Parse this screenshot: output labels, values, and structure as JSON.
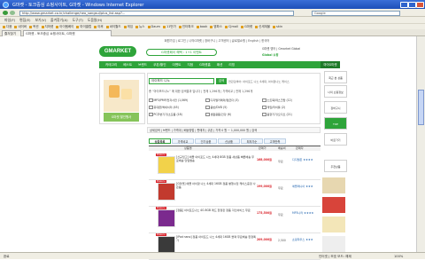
{
  "window": {
    "title": "G마켓 - 토크중심 쇼핑사이트, G마켓 - Windows Internet Explorer"
  },
  "address": {
    "url": "http://www.gmarket.co.kr/challenge/neo_sangsul/plus_list.asp?...",
    "search_placeholder": "Google"
  },
  "menu": [
    "파일(F)",
    "편집(E)",
    "보기(V)",
    "즐겨찾기(A)",
    "도구(T)",
    "도움말(H)"
  ],
  "links": [
    "다음",
    "네이버",
    "옥션",
    "지마켓",
    "아이템베이",
    "마이클럽",
    "야후",
    "싸이월드",
    "게임",
    "뉴스",
    "Daum",
    "11번가",
    "인터파크",
    "book",
    "엠파스",
    "CJmall",
    "G마켓",
    "신세계몰",
    "skin"
  ],
  "tabs": [
    {
      "label": "즐겨찾기"
    },
    {
      "label": "G마켓 - 토크중심 쇼핑사이트, G마켓"
    }
  ],
  "topnav": {
    "text": "회원가입 | 로그인 | 나의G마켓 | 장바구니 | 고객센터 | 글로벌쇼핑 | English | 한국어"
  },
  "logo": {
    "text": "GMARKET"
  },
  "promo": {
    "text": "G마켓페이 혜택 : 1+1 이벤트"
  },
  "rightlogos": {
    "line1": "G마켓 영어 | Gmarket Global",
    "line2": "Global 쇼핑"
  },
  "nav": {
    "items": [
      "카테고리",
      "베스트",
      "브랜드",
      "쿠폰/할인",
      "이벤트",
      "지점",
      "G마켓홈",
      "패션",
      "리빙"
    ],
    "right": "마이G마켓"
  },
  "leftad": {
    "label": "G마켓 할인행사"
  },
  "search": {
    "value": "아이포드 나노",
    "button": "검색",
    "hint": "연관검색어: 아이포드 나노 4세대, 아이팟나노 케이스"
  },
  "result_info": "총 “아이포드나노” 에 대한 검색결과 입니다 | 전체 1,296개 | 가격비교 | 전체 1,296개",
  "categories": [
    {
      "label": "MP3/PMP/전자사전 (1,069)"
    },
    {
      "label": "디지털카메라/캠코더 (3)"
    },
    {
      "label": "노트북/데스크탑 (12)"
    },
    {
      "label": "휴대폰/액세서리 (45)"
    },
    {
      "label": "음반/DVD (5)"
    },
    {
      "label": "게임/타이틀 (2)"
    },
    {
      "label": "PC주변기기/소모품 (18)"
    },
    {
      "label": "생활용품/건강 (6)"
    },
    {
      "label": "음향기기/오디오 (21)"
    }
  ],
  "filter": {
    "text": "상세검색 | 브랜드 | 가격대 | 배송방법 | 판매자 | 쿠폰 | 가격 0 원 ~ 1,000,000 원 | 검색"
  },
  "subtabs": [
    "상품목록",
    "가격비교",
    "인기상품",
    "신상품",
    "최저가순",
    "고객만족"
  ],
  "sort": {
    "item": "상품명",
    "price": "판매가",
    "shipping": "배송비",
    "seller": "판매자"
  },
  "products": [
    {
      "tag": "Power+",
      "desc": "[신규입고] 애플 아이포드 나노 4세대 8GB 정품 새상품 빠른배송 무료배송 당일발송",
      "price": "168,000원",
      "ship": "무료",
      "seller": "디지털존 ★★★★"
    },
    {
      "tag": "Power+",
      "desc": "[G마켓] 애플 아이팟 나노 4세대 16GB 정품 병행수입 케이스증정 사은품",
      "price": "199,000원",
      "ship": "무료",
      "seller": "애플매니아 ★★★"
    },
    {
      "tag": "Power+",
      "desc": "[정품] 아이포드나노 4G 8GB 레드 한정판 정품 각인서비스 무료",
      "price": "175,500원",
      "ship": "무료",
      "seller": "MP3나라 ★★★★"
    },
    {
      "tag": "Power+",
      "desc": "[iPod nano] 정품 아이포드 나노 4세대 16GB 블랙 무료배송 한정특가",
      "price": "209,000원",
      "ship": "2,500",
      "seller": "쇼핑하우스 ★★★"
    }
  ],
  "right": {
    "boxes": [
      "최근 본 상품",
      "나의 쇼핑정보",
      "장바구니",
      "TOP",
      "바로가기",
      "추천상품"
    ]
  },
  "status": {
    "text": "완료",
    "zone": "인터넷 | 보호 모드: 해제",
    "zoom": "100%"
  }
}
